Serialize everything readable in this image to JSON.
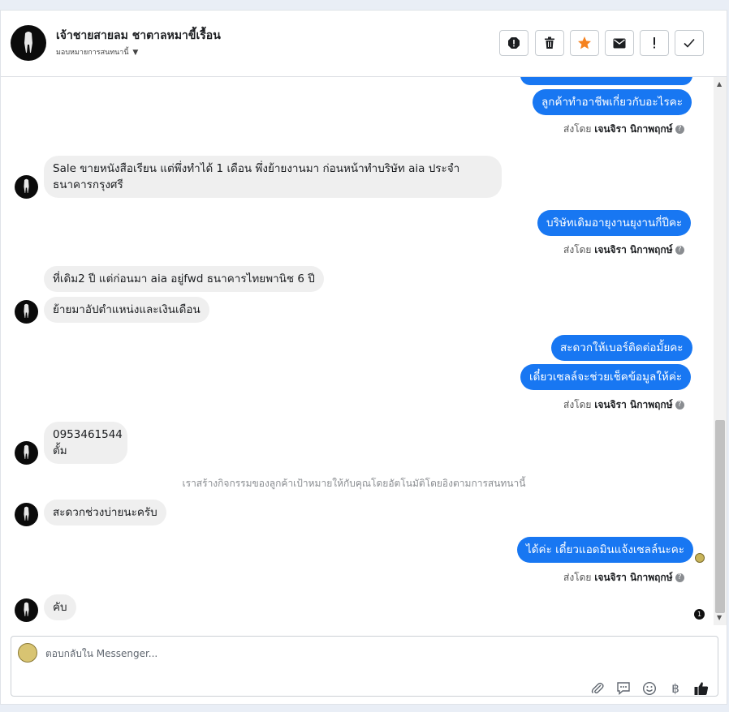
{
  "header": {
    "name": "เจ้าชายสายลม ชาตาลหมาขี้เรื้อน",
    "assign_label": "มอบหมายการสนทนานี้",
    "actions": [
      "spam-icon",
      "trash-icon",
      "star-icon",
      "envelope-icon",
      "exclamation-icon",
      "check-icon"
    ]
  },
  "colors": {
    "accent": "#1877f2",
    "star": "#f5821f",
    "incoming": "#efefef"
  },
  "messages": {
    "m1": "ลูกค้าทำอาชีพเกี่ยวกับอะไรคะ",
    "m2_line1": "Sale ขายหนังสือเรียน แต่พึ่งทำได้ 1 เดือน พึ่งย้ายงานมา  ก่อนหน้าทำบริษัท aia ประจำ",
    "m2_line2": "ธนาคารกรุงศรี",
    "m3": "บริษัทเดิมอายุงานยุงานกี่ปีคะ",
    "m4": "ที่เดิม2 ปี  แต่ก่อนมา aia อยู่fwd ธนาคารไทยพานิช  6 ปี",
    "m5": "ย้ายมาอัปตำแหน่งและเงินเดือน",
    "m6": "สะดวกให้เบอร์ติดต่อมั้ยคะ",
    "m7": "เดี๋ยวเซลล์จะช่วยเช็คข้อมูลให้ค่ะ",
    "m8_line1": "0953461544",
    "m8_line2": "ตั้ม",
    "system": "เราสร้างกิจกรรมของลูกค้าเป้าหมายให้กับคุณโดยอัตโนมัติโดยอิงตามการสนทนานี้",
    "m9": "สะดวกช่วงบ่ายนะครับ",
    "m10": "ได้ค่ะ เดี๋ยวแอดมินแจ้งเซลล์นะคะ",
    "m11": "คับ"
  },
  "sent_by": {
    "prefix": "ส่งโดย",
    "name": "เจนจิรา นิกาพฤกษ์"
  },
  "read_count": "1",
  "reply": {
    "placeholder": "ตอบกลับใน Messenger..."
  },
  "tools": [
    "attachment-icon",
    "saved-reply-icon",
    "emoji-icon",
    "baht-icon",
    "like-icon"
  ]
}
